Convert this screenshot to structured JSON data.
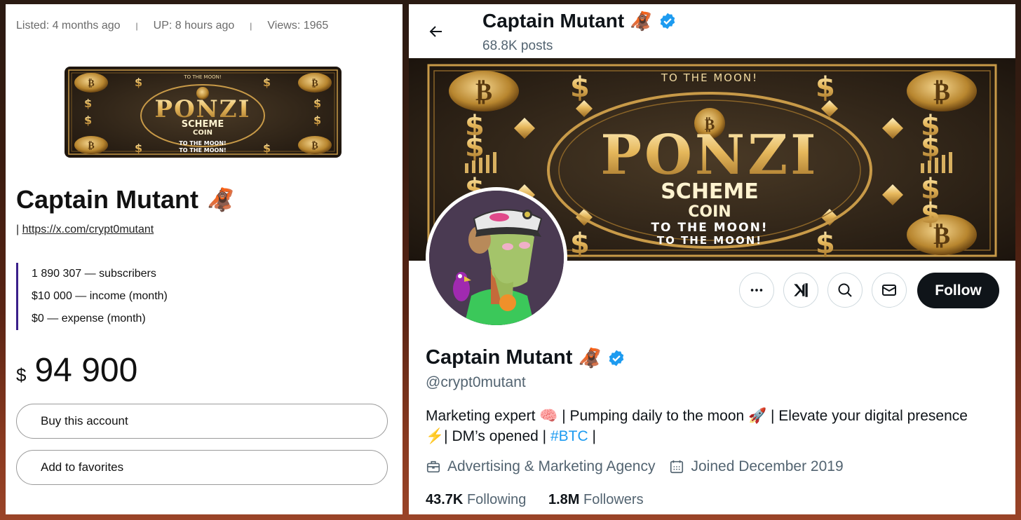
{
  "listing": {
    "meta": {
      "listed": "Listed: 4 months ago",
      "separator": "|",
      "up": "UP: 8 hours ago",
      "views": "Views: 1965"
    },
    "thumbnail": {
      "alt": "Ponzi Scheme Coin banner",
      "text_top": "TO THE MOON!",
      "text_main": "PONZI",
      "text_sub": "SCHEME",
      "text_coin": "COIN",
      "text_bottom_1": "TO THE MOON!",
      "text_bottom_2": "TO THE MOON!"
    },
    "title": "Captain Mutant",
    "title_emoji": "🦧",
    "link_prefix": "|",
    "link": "https://x.com/crypt0mutant",
    "stats": [
      "1 890 307 — subscribers",
      "$10 000 — income (month)",
      "$0 — expense (month)"
    ],
    "price": {
      "currency": "$",
      "amount": "94 900"
    },
    "buttons": {
      "buy": "Buy this account",
      "favorites": "Add to favorites"
    },
    "accent_color": "#3a1f8a"
  },
  "profile": {
    "header": {
      "back_icon": "arrow-left-icon",
      "name": "Captain Mutant",
      "emoji": "🦧",
      "verified": true,
      "posts": "68.8K posts"
    },
    "banner": {
      "text_top": "TO THE MOON!",
      "text_main": "PONZI",
      "text_sub": "SCHEME",
      "text_coin": "COIN",
      "text_bottom_1": "TO THE MOON!",
      "text_bottom_2": "TO THE MOON!"
    },
    "actions": {
      "more_icon": "more-icon",
      "grok_icon": "grok-icon",
      "search_icon": "search-icon",
      "message_icon": "mail-icon",
      "follow": "Follow"
    },
    "name": "Captain Mutant",
    "emoji": "🦧",
    "handle": "@crypt0mutant",
    "bio": {
      "part1": "Marketing expert ",
      "emoji_brain": "🧠",
      "part2": " | Pumping daily to the moon ",
      "emoji_rocket": "🚀",
      "part3": " | Elevate your digital presence ",
      "emoji_zap": "⚡",
      "part4": "| DM’s opened | ",
      "hashtag": "#BTC",
      "part5": " |"
    },
    "category": "Advertising & Marketing Agency",
    "joined": "Joined December 2019",
    "following_count": "43.7K",
    "following_label": "Following",
    "followers_count": "1.8M",
    "followers_label": "Followers",
    "colors": {
      "verified": "#1d9bf0",
      "link": "#1d9bf0",
      "follow_bg": "#0f1419"
    }
  }
}
